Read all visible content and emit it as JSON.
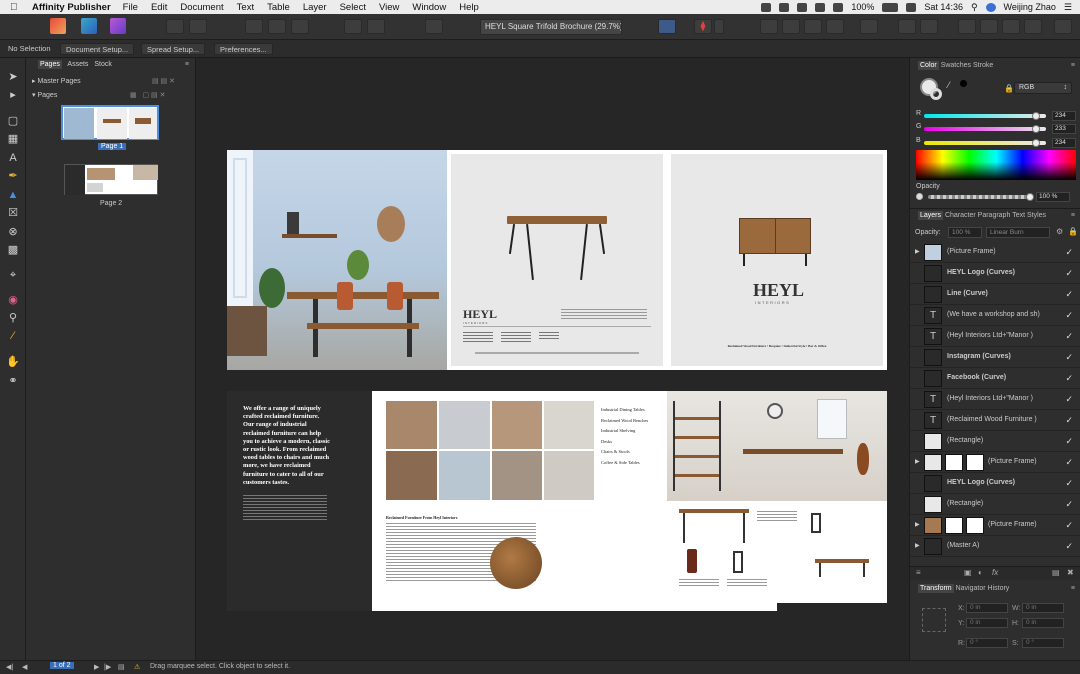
{
  "menubar": {
    "app": "Affinity Publisher",
    "items": [
      "File",
      "Edit",
      "Document",
      "Text",
      "Table",
      "Layer",
      "Select",
      "View",
      "Window",
      "Help"
    ],
    "battery": "100%",
    "clock": "Sat 14:36",
    "user": "Weijing Zhao"
  },
  "toolbar": {
    "document_title": "HEYL Square Trifold Brochure (29.7%)"
  },
  "context": {
    "selection": "No Selection",
    "document_setup": "Document Setup...",
    "spread_setup": "Spread Setup...",
    "preferences": "Preferences..."
  },
  "pages_panel": {
    "tabs": [
      "Pages",
      "Assets",
      "Stock"
    ],
    "master_pages": "Master Pages",
    "pages": "Pages",
    "page1": "Page 1",
    "page2": "Page 2"
  },
  "color_panel": {
    "tabs": [
      "Color",
      "Swatches",
      "Stroke"
    ],
    "mode": "RGB",
    "r_label": "R",
    "r": "234",
    "g_label": "G",
    "g": "233",
    "b_label": "B",
    "b": "234",
    "opacity_label": "Opacity",
    "opacity": "100 %"
  },
  "layers_panel": {
    "tabs": [
      "Layers",
      "Character",
      "Paragraph",
      "Text Styles"
    ],
    "opacity_label": "Opacity:",
    "opacity": "100 %",
    "blend": "Linear Burn",
    "layers": [
      "(Picture Frame)",
      "HEYL Logo (Curves)",
      "Line (Curve)",
      "(We have a workshop and sh)",
      "(Heyl Interiors Ltd+\"Manor )",
      "Instagram (Curves)",
      "Facebook (Curve)",
      "(Heyl Interiors Ltd+\"Manor )",
      "(Reclaimed Wood Furniture )",
      "(Rectangle)",
      "(Picture Frame)",
      "HEYL Logo (Curves)",
      "(Rectangle)",
      "(Picture Frame)",
      "(Master A)"
    ]
  },
  "transform_panel": {
    "tabs": [
      "Transform",
      "Navigator",
      "History"
    ],
    "x_label": "X:",
    "x": "0 in",
    "y_label": "Y:",
    "y": "0 in",
    "w_label": "W:",
    "w": "0 in",
    "h_label": "H:",
    "h": "0 in",
    "r_label": "R:",
    "r": "0 °",
    "s_label": "S:",
    "s": "0 °"
  },
  "statusbar": {
    "page_indicator": "1 of 2",
    "hint": "Drag marquee select. Click object to select it."
  },
  "brochure": {
    "outside_text": "Reclaimed Wood Furniture • Bespoke • Industrial Style • Bar & Office",
    "logo": "HEYL",
    "logo_sub": "INTERIORS",
    "inside_headline": "We offer a range of uniquely crafted reclaimed furniture. Our range of industrial reclaimed furniture can help you to achieve a modern, classic or rustic look. From reclaimed wood tables to chairs and much more, we have reclaimed furniture to cater to all of our customers tastes.",
    "categories": [
      "Industrial Dining Tables",
      "Reclaimed Wood Benches",
      "Industrial Shelving",
      "Desks",
      "Chairs & Stools",
      "Coffee & Side Tables"
    ],
    "section_title": "Reclaimed Furniture From Heyl Interiors"
  },
  "colors": {
    "accent": "#4a8fe0",
    "panel": "#2e2e2e",
    "canvas": "#262626"
  }
}
